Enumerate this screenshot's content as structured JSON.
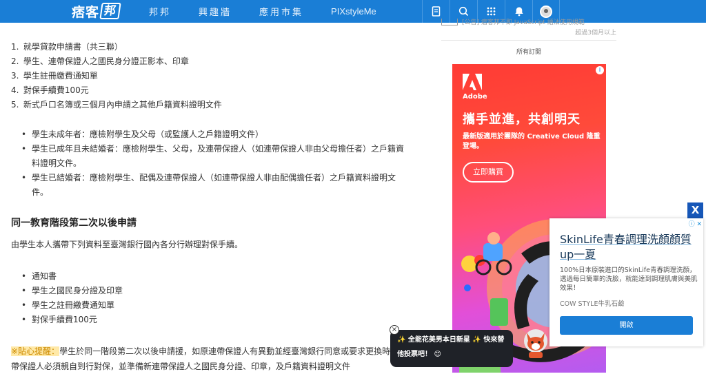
{
  "topbar": {
    "logo_text": "痞客",
    "logo_box": "邦",
    "nav": [
      "邦邦",
      "興趣牆",
      "應用市集",
      "PIXstyleMe"
    ],
    "icons": [
      "bookmark-icon",
      "search-icon",
      "grid-icon",
      "bell-icon",
      "avatar"
    ]
  },
  "article": {
    "numbered_list": [
      {
        "num": "1.",
        "text": "就學貸款申請書（共三聯）"
      },
      {
        "num": "2.",
        "text": "學生、連帶保證人之國民身分證正影本、印章"
      },
      {
        "num": "3.",
        "text": "學生註冊繳費通知單"
      },
      {
        "num": "4.",
        "text": "對保手續費100元"
      },
      {
        "num": "5.",
        "text": "新式戶口名簿或三個月內申請之其他戶籍資料證明文件"
      }
    ],
    "bullets_1": [
      "學生未成年者：應檢附學生及父母（或監護人之戶籍證明文件）",
      "學生已成年且未結婚者：應檢附學生、父母，及連帶保證人（如連帶保證人非由父母擔任者）之戶籍資料證明文件。",
      "學生已結婚者：應檢附學生、配偶及連帶保證人（如連帶保證人非由配偶擔任者）之戶籍資料證明文件。"
    ],
    "heading": "同一教育階段第二次以後申請",
    "paragraph": "由學生本人攜帶下列資料至臺灣銀行國內各分行辦理對保手續。",
    "bullets_2": [
      "通知書",
      "學生之國民身分證及印章",
      "學生之註冊繳費通知單",
      "對保手續費100元"
    ],
    "tip_label": "※貼心提醒：",
    "tip_text": "學生於同一階段第二次以後申請援，如原連帶保證人有異動並經臺灣銀行同意或要求更換時，新連帶保證人必須親自到行對保，並準備新連帶保證人之國民身分證、印章，及戶籍資料證明文件"
  },
  "sidebar": {
    "notice_text": "[公告] 痞客邦不即 JavaScript 語法使用規範",
    "notice_time": "超過3個月以上",
    "section_label": "所有訂閱"
  },
  "adobe_ad": {
    "brand": "Adobe",
    "title": "攜手並進，共創明天",
    "desc": "最新版適用於團隊的 Creative Cloud 隆重登場。",
    "button": "立即購買",
    "colors": {
      "top": "#ff3b35",
      "bottom": "#b45cf0"
    }
  },
  "float_ad": {
    "close": "X",
    "adchoice": "ⓘ ✕",
    "title": "SkinLife青春調理洗顏顏質up一夏",
    "body": "100%日本原裝進口的SkinLife青春調理洗顏，透過每日簡單的洗臉，就能達到調理肌膚與美肌效果！",
    "source": "COW STYLE牛乳石鹼",
    "button": "開啟",
    "accent": "#1a7ed6"
  },
  "toast": {
    "line1": "✨ 全能花美男本日新星 ✨ 快來替",
    "line2": "他投票吧！ 😊",
    "close": "×"
  }
}
